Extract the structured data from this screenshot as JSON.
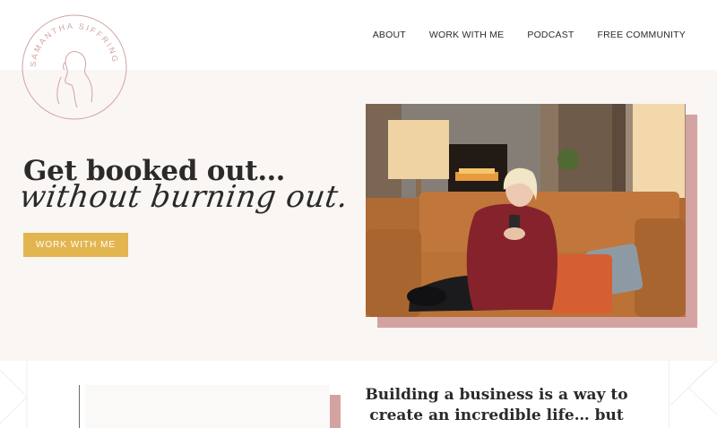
{
  "logo": {
    "text": "SAMANTHA SIFFRING"
  },
  "nav": {
    "items": [
      "ABOUT",
      "WORK WITH ME",
      "PODCAST",
      "FREE COMMUNITY"
    ]
  },
  "hero": {
    "headline": "Get booked out…",
    "script_line": "without burning out.",
    "cta_label": "WORK WITH ME"
  },
  "colors": {
    "accent_gold": "#e3b54f",
    "accent_pink": "#d3a3a2",
    "hero_bg": "#faf6f3",
    "text": "#2c2a29"
  },
  "lower": {
    "heading_line1": "Building a business is a way to",
    "heading_line2": "create an incredible life… but"
  }
}
